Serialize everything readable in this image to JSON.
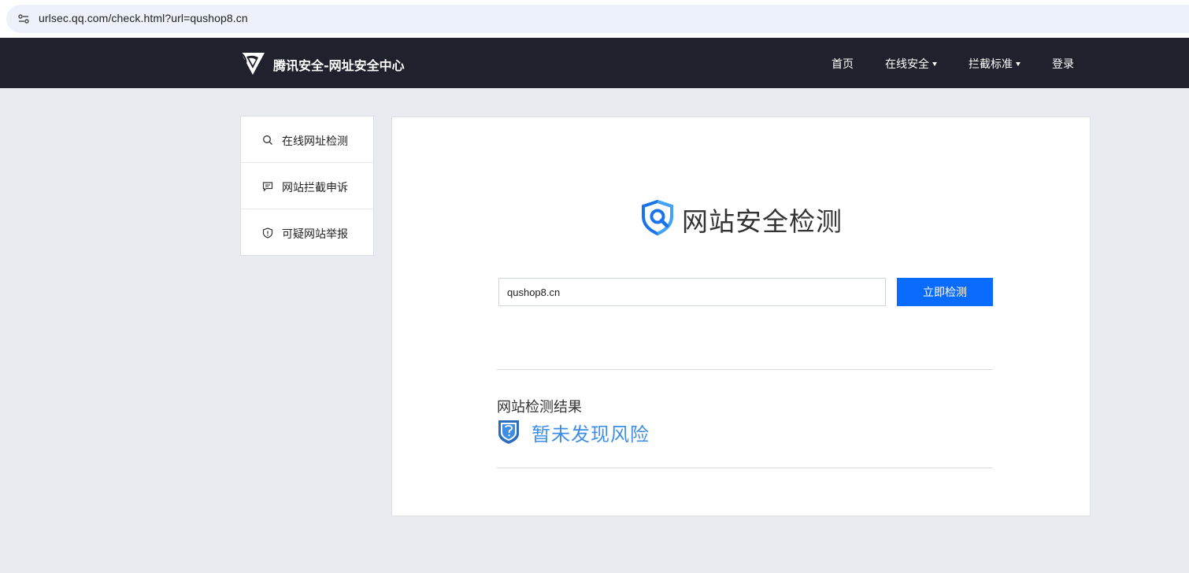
{
  "browser": {
    "url": "urlsec.qq.com/check.html?url=qushop8.cn"
  },
  "header": {
    "brand": "腾讯安全-网址安全中心",
    "nav": {
      "home": "首页",
      "online_security": "在线安全",
      "block_standard": "拦截标准",
      "login": "登录"
    }
  },
  "sidebar": {
    "items": [
      {
        "label": "在线网址检测",
        "icon": "search-icon"
      },
      {
        "label": "网站拦截申诉",
        "icon": "message-icon"
      },
      {
        "label": "可疑网站举报",
        "icon": "shield-alert-icon"
      }
    ]
  },
  "main": {
    "title": "网站安全检测",
    "input_value": "qushop8.cn",
    "check_button": "立即检测",
    "result_heading": "网站检测结果",
    "result_status": "暂未发现风险"
  },
  "colors": {
    "navbar_bg": "#1f222d",
    "primary": "#0a6cff",
    "result_blue": "#3f8ee6",
    "page_bg": "#e9ebf0"
  }
}
